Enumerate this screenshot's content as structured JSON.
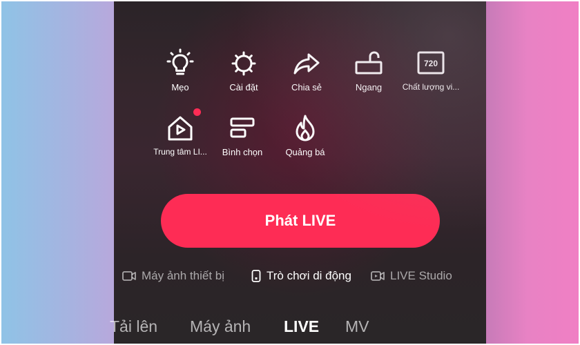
{
  "menu": {
    "row1": [
      {
        "label": "Mẹo",
        "icon": "lightbulb-icon"
      },
      {
        "label": "Cài đặt",
        "icon": "gear-icon"
      },
      {
        "label": "Chia sẻ",
        "icon": "share-arrow-icon"
      },
      {
        "label": "Ngang",
        "icon": "landscape-rotate-icon"
      },
      {
        "label": "Chất lượng vi...",
        "icon": "quality-720-icon",
        "badge": "720"
      }
    ],
    "row2": [
      {
        "label": "Trung tâm LI...",
        "icon": "live-center-home-icon",
        "has_notification": true
      },
      {
        "label": "Bình chọn",
        "icon": "poll-icon"
      },
      {
        "label": "Quảng bá",
        "icon": "flame-icon"
      }
    ]
  },
  "primary_action": {
    "label": "Phát LIVE",
    "color": "#fe2c55"
  },
  "source_modes": [
    {
      "label": "Máy ảnh thiết bị",
      "icon": "camera-icon",
      "selected": false
    },
    {
      "label": "Trò chơi di động",
      "icon": "phone-icon",
      "selected": true
    },
    {
      "label": "LIVE Studio",
      "icon": "studio-icon",
      "selected": false
    }
  ],
  "tabs": [
    {
      "label": "Tải lên"
    },
    {
      "label": "Máy ảnh"
    },
    {
      "label": "LIVE",
      "active": true
    },
    {
      "label": "MV"
    }
  ]
}
